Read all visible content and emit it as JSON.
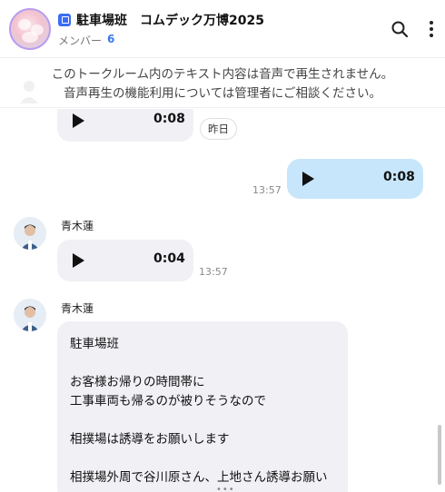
{
  "header": {
    "title": "駐車場班　コムデック万博2025",
    "member_label": "メンバー",
    "member_count": "6",
    "search_icon": "search-icon",
    "more_icon": "more-vertical-icon"
  },
  "notice": {
    "line1": "このトークルーム内のテキスト内容は音声で再生されません。",
    "line2": "音声再生の機能利用については管理者にご相談ください。"
  },
  "messages": {
    "m1": {
      "duration": "0:08",
      "day_label": "昨日"
    },
    "m2": {
      "duration": "0:08",
      "time": "13:57"
    },
    "m3": {
      "sender": "青木蓮",
      "duration": "0:04",
      "time": "13:57"
    },
    "m4": {
      "sender": "青木蓮",
      "lines": [
        "駐車場班",
        "",
        "お客様お帰りの時間帯に",
        "工事車両も帰るのが被りそうなので",
        "",
        "相撲場は誘導をお願いします",
        "",
        "相撲場外周で谷川原さん、上地さん誘導お願い"
      ]
    }
  },
  "footer": {
    "more_dots": "•••"
  },
  "colors": {
    "accent": "#3a78f2",
    "outgoing_bubble": "#c7e6fb",
    "incoming_bubble": "#f0f0f5"
  }
}
